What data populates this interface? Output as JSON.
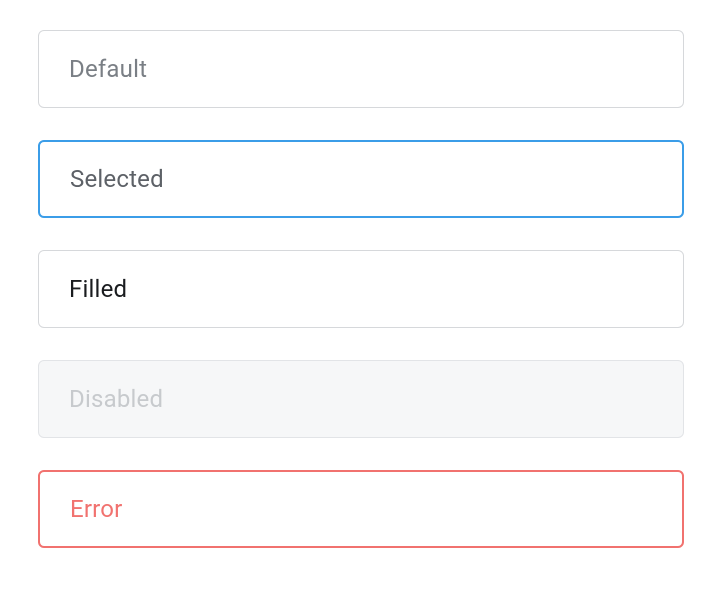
{
  "fields": {
    "default": {
      "label": "Default"
    },
    "selected": {
      "label": "Selected"
    },
    "filled": {
      "label": "Filled"
    },
    "disabled": {
      "label": "Disabled"
    },
    "error": {
      "label": "Error"
    }
  }
}
